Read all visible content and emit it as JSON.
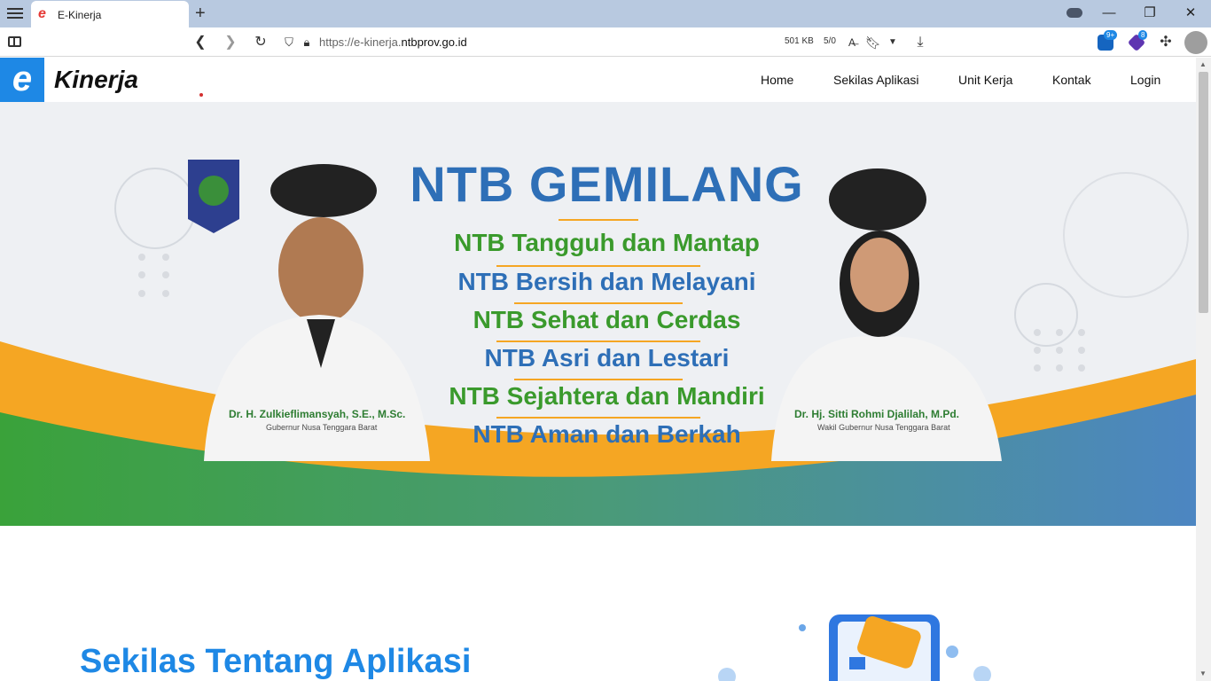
{
  "browser": {
    "tab_title": "E-Kinerja",
    "url_prefix": "https://e-kinerja.",
    "url_domain": "ntbprov.go.id",
    "page_size": "501 KB",
    "counter": "5/0",
    "ext_badge_1": "9+",
    "ext_badge_2": "8"
  },
  "site": {
    "logo_letter": "e",
    "brand": "Kinerja",
    "nav": [
      "Home",
      "Sekilas Aplikasi",
      "Unit Kerja",
      "Kontak",
      "Login"
    ]
  },
  "hero": {
    "title": "NTB GEMILANG",
    "mottos": [
      "NTB Tangguh dan Mantap",
      "NTB Bersih dan Melayani",
      "NTB Sehat dan Cerdas",
      "NTB Asri dan Lestari",
      "NTB Sejahtera dan Mandiri",
      "NTB Aman dan Berkah"
    ],
    "left_name": "Dr. H. Zulkieflimansyah, S.E., M.Sc.",
    "left_role": "Gubernur Nusa Tenggara Barat",
    "right_name": "Dr. Hj. Sitti Rohmi Djalilah, M.Pd.",
    "right_role": "Wakil Gubernur Nusa Tenggara Barat",
    "colors": {
      "blue": "#2e6fb7",
      "green": "#3a9a2c",
      "orange": "#f5a623"
    }
  },
  "about": {
    "title": "Sekilas Tentang Aplikasi"
  }
}
